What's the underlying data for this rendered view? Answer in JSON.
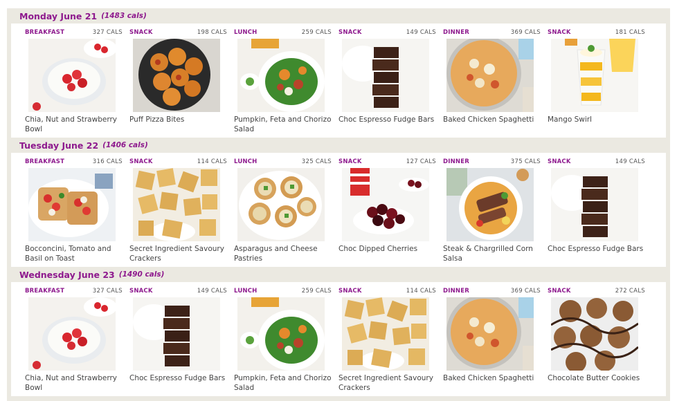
{
  "days": [
    {
      "title": "Monday June 21",
      "cals": "(1483 cals)",
      "meals": [
        {
          "type": "BREAKFAST",
          "cals": "327 CALS",
          "name": "Chia, Nut and Strawberry Bowl",
          "image": "chia-bowl"
        },
        {
          "type": "SNACK",
          "cals": "198 CALS",
          "name": "Puff Pizza Bites",
          "image": "pizza-bites"
        },
        {
          "type": "LUNCH",
          "cals": "259 CALS",
          "name": "Pumpkin, Feta and Chorizo Salad",
          "image": "salad"
        },
        {
          "type": "SNACK",
          "cals": "149 CALS",
          "name": "Choc Espresso Fudge Bars",
          "image": "fudge"
        },
        {
          "type": "DINNER",
          "cals": "369 CALS",
          "name": "Baked Chicken Spaghetti",
          "image": "spaghetti"
        },
        {
          "type": "SNACK",
          "cals": "181 CALS",
          "name": "Mango Swirl",
          "image": "mango"
        }
      ]
    },
    {
      "title": "Tuesday June 22",
      "cals": "(1406 cals)",
      "meals": [
        {
          "type": "BREAKFAST",
          "cals": "316 CALS",
          "name": "Bocconcini, Tomato and Basil on Toast",
          "image": "toast"
        },
        {
          "type": "SNACK",
          "cals": "114 CALS",
          "name": "Secret Ingredient Savoury Crackers",
          "image": "crackers"
        },
        {
          "type": "LUNCH",
          "cals": "325 CALS",
          "name": "Asparagus and Cheese Pastries",
          "image": "pastries"
        },
        {
          "type": "SNACK",
          "cals": "127 CALS",
          "name": "Choc Dipped Cherries",
          "image": "cherries"
        },
        {
          "type": "DINNER",
          "cals": "375 CALS",
          "name": "Steak & Chargrilled Corn Salsa",
          "image": "steak"
        },
        {
          "type": "SNACK",
          "cals": "149 CALS",
          "name": "Choc Espresso Fudge Bars",
          "image": "fudge"
        }
      ]
    },
    {
      "title": "Wednesday June 23",
      "cals": "(1490 cals)",
      "meals": [
        {
          "type": "BREAKFAST",
          "cals": "327 CALS",
          "name": "Chia, Nut and Strawberry Bowl",
          "image": "chia-bowl"
        },
        {
          "type": "SNACK",
          "cals": "149 CALS",
          "name": "Choc Espresso Fudge Bars",
          "image": "fudge"
        },
        {
          "type": "LUNCH",
          "cals": "259 CALS",
          "name": "Pumpkin, Feta and Chorizo Salad",
          "image": "salad"
        },
        {
          "type": "SNACK",
          "cals": "114 CALS",
          "name": "Secret Ingredient Savoury Crackers",
          "image": "crackers"
        },
        {
          "type": "DINNER",
          "cals": "369 CALS",
          "name": "Baked Chicken Spaghetti",
          "image": "spaghetti"
        },
        {
          "type": "SNACK",
          "cals": "272 CALS",
          "name": "Chocolate Butter Cookies",
          "image": "cookies"
        }
      ]
    }
  ],
  "colors": {
    "accent": "#8e1a8e",
    "header_bg": "#ebe9e1",
    "text": "#444444"
  }
}
